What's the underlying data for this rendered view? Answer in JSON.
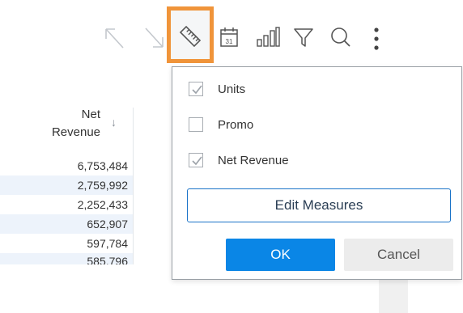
{
  "toolbar": {
    "icons": [
      "expand-arrow-icon",
      "collapse-arrow-icon",
      "ruler-icon",
      "calendar-icon",
      "bar-chart-icon",
      "filter-icon",
      "search-icon",
      "more-vertical-icon"
    ],
    "calendar_day": "31",
    "highlight_color": "#f0943a"
  },
  "table": {
    "header_line1": "Net",
    "header_line2": "Revenue",
    "sort_indicator": "↓",
    "rows": [
      "6,753,484",
      "2,759,992",
      "2,252,433",
      "652,907",
      "597,784",
      "585,796"
    ]
  },
  "dropdown": {
    "options": [
      {
        "label": "Units",
        "checked": true
      },
      {
        "label": "Promo",
        "checked": false
      },
      {
        "label": "Net Revenue",
        "checked": true
      }
    ],
    "edit_label": "Edit Measures",
    "ok_label": "OK",
    "cancel_label": "Cancel"
  },
  "colors": {
    "primary": "#0a86e6",
    "row_alt": "#edf3fb",
    "button_border": "#1a73c8"
  }
}
